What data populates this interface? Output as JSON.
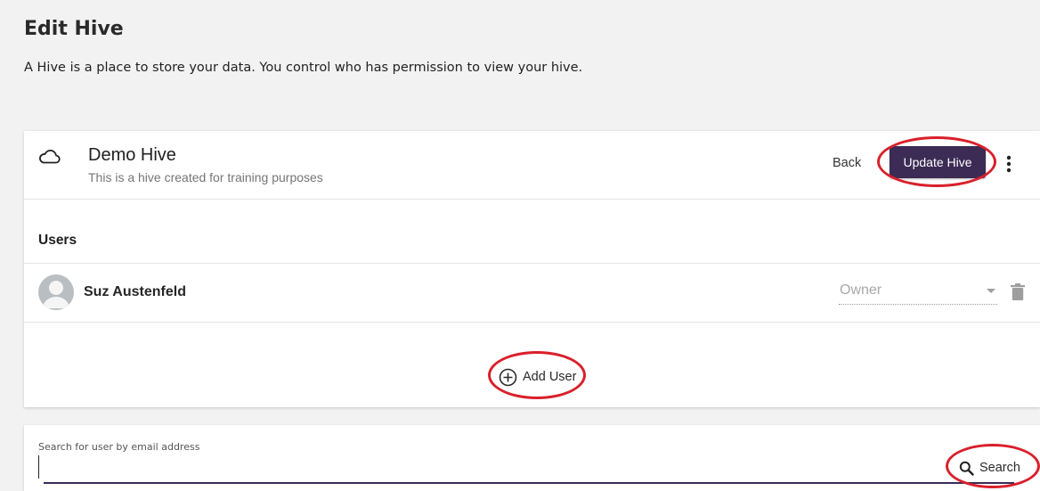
{
  "page": {
    "title": "Edit Hive",
    "description": "A Hive is a place to store your data. You control who has permission to view your hive."
  },
  "hive": {
    "icon": "cloud-icon",
    "name": "Demo Hive",
    "description": "This is a hive created for training purposes"
  },
  "header_actions": {
    "back_label": "Back",
    "update_label": "Update Hive",
    "more_icon": "more-vertical-icon"
  },
  "users": {
    "heading": "Users",
    "items": [
      {
        "name": "Suz Austenfeld",
        "role": "Owner",
        "avatar_icon": "person-icon",
        "delete_icon": "trash-icon"
      }
    ],
    "add_label": "Add User",
    "add_icon": "plus-circle-icon"
  },
  "search": {
    "label": "Search for user by email address",
    "value": "",
    "button_label": "Search",
    "icon": "search-icon"
  },
  "colors": {
    "primary": "#3b2b55",
    "highlight": "#d9202a",
    "background": "#f2f2f2"
  }
}
